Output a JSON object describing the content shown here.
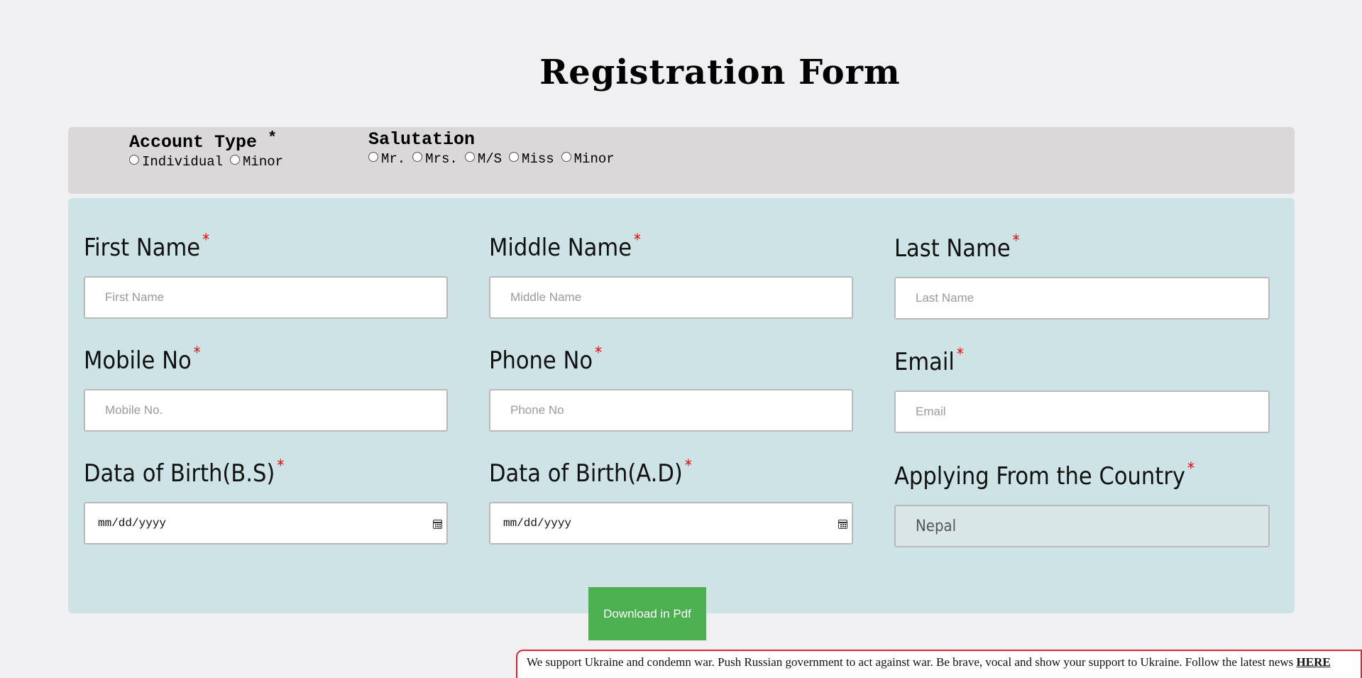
{
  "title": "Registration Form",
  "account_type": {
    "label": "Account Type",
    "required_mark": "*",
    "options": [
      "Individual",
      "Minor"
    ]
  },
  "salutation": {
    "label": "Salutation",
    "options": [
      "Mr.",
      "Mrs.",
      "M/S",
      "Miss",
      "Minor"
    ]
  },
  "fields": {
    "first_name": {
      "label": "First Name",
      "placeholder": "First Name"
    },
    "middle_name": {
      "label": "Middle Name",
      "placeholder": "Middle Name"
    },
    "last_name": {
      "label": "Last Name",
      "placeholder": "Last Name"
    },
    "mobile_no": {
      "label": "Mobile No",
      "placeholder": "Mobile No."
    },
    "phone_no": {
      "label": "Phone No",
      "placeholder": "Phone No"
    },
    "email": {
      "label": "Email",
      "placeholder": "Email"
    },
    "dob_bs": {
      "label": "Data of Birth(B.S)",
      "value": "mm/dd/yyyy"
    },
    "dob_ad": {
      "label": "Data of Birth(A.D)",
      "value": "mm/dd/yyyy"
    },
    "country": {
      "label": "Applying From the Country",
      "value": "Nepal"
    }
  },
  "required_mark": "*",
  "download_button": "Download in Pdf",
  "banner": {
    "text": "We support Ukraine and condemn war. Push Russian government to act against war. Be brave, vocal and show your support to Ukraine. Follow the latest news ",
    "link": "HERE"
  },
  "colors": {
    "top_panel": "#dad8d9",
    "main_panel": "#cde3e6",
    "button": "#4caf50",
    "required": "#ee0000",
    "banner_border": "#d9253a"
  }
}
